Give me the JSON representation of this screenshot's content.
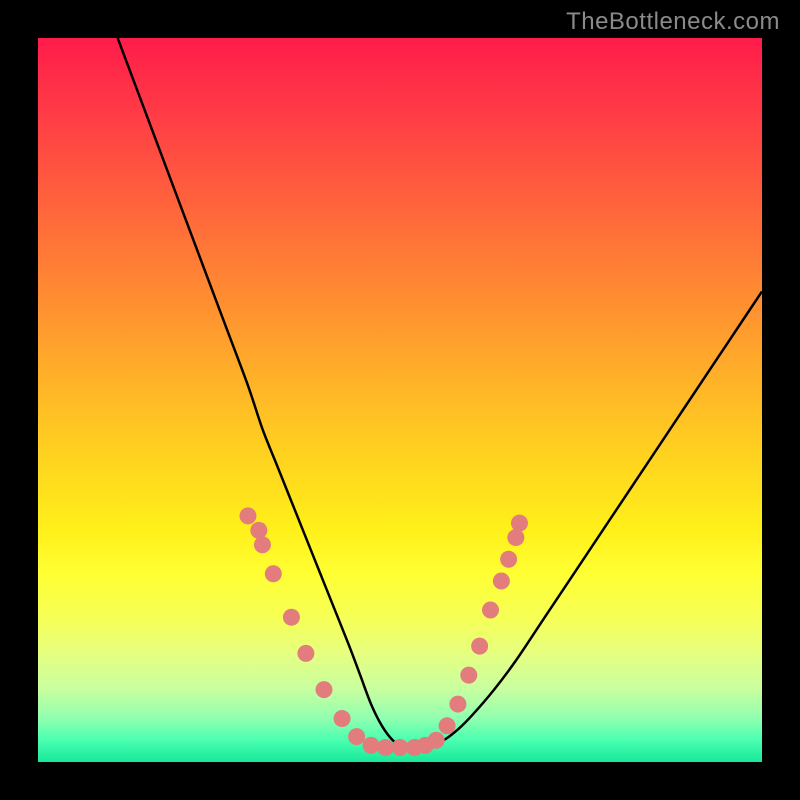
{
  "watermark": "TheBottleneck.com",
  "colors": {
    "frame": "#000000",
    "curve": "#000000",
    "marker_fill": "#e37c7c",
    "marker_stroke": "#b85a5a",
    "gradient_stops": [
      {
        "offset": 0.0,
        "color": "#ff1c4a"
      },
      {
        "offset": 0.1,
        "color": "#ff3a46"
      },
      {
        "offset": 0.2,
        "color": "#ff5a3e"
      },
      {
        "offset": 0.3,
        "color": "#ff7a36"
      },
      {
        "offset": 0.4,
        "color": "#ff9a2e"
      },
      {
        "offset": 0.5,
        "color": "#ffbb26"
      },
      {
        "offset": 0.6,
        "color": "#ffd91e"
      },
      {
        "offset": 0.68,
        "color": "#fff01a"
      },
      {
        "offset": 0.74,
        "color": "#ffff33"
      },
      {
        "offset": 0.8,
        "color": "#f6ff55"
      },
      {
        "offset": 0.85,
        "color": "#e6ff80"
      },
      {
        "offset": 0.9,
        "color": "#c8ffa0"
      },
      {
        "offset": 0.94,
        "color": "#90ffb0"
      },
      {
        "offset": 0.97,
        "color": "#4affb0"
      },
      {
        "offset": 1.0,
        "color": "#18e89a"
      }
    ]
  },
  "chart_data": {
    "type": "line",
    "title": "",
    "xlabel": "",
    "ylabel": "",
    "xlim": [
      0,
      100
    ],
    "ylim": [
      0,
      100
    ],
    "series": [
      {
        "name": "curve",
        "x": [
          11,
          14,
          17,
          20,
          23,
          26,
          29,
          31,
          33,
          35,
          37,
          39,
          41,
          43,
          44.5,
          46,
          47.5,
          49,
          50.5,
          52,
          54,
          56,
          58,
          60,
          63,
          66,
          70,
          74,
          78,
          82,
          86,
          90,
          94,
          98,
          100
        ],
        "y": [
          100,
          92,
          84,
          76,
          68,
          60,
          52,
          46,
          41,
          36,
          31,
          26,
          21,
          16,
          12,
          8,
          5,
          3,
          2,
          2,
          2.3,
          3,
          4.5,
          6.5,
          10,
          14,
          20,
          26,
          32,
          38,
          44,
          50,
          56,
          62,
          65
        ]
      }
    ],
    "markers": {
      "name": "data-points",
      "points": [
        {
          "x": 29.0,
          "y": 34.0
        },
        {
          "x": 30.5,
          "y": 32.0
        },
        {
          "x": 31.0,
          "y": 30.0
        },
        {
          "x": 32.5,
          "y": 26.0
        },
        {
          "x": 35.0,
          "y": 20.0
        },
        {
          "x": 37.0,
          "y": 15.0
        },
        {
          "x": 39.5,
          "y": 10.0
        },
        {
          "x": 42.0,
          "y": 6.0
        },
        {
          "x": 44.0,
          "y": 3.5
        },
        {
          "x": 46.0,
          "y": 2.3
        },
        {
          "x": 48.0,
          "y": 2.0
        },
        {
          "x": 50.0,
          "y": 2.0
        },
        {
          "x": 52.0,
          "y": 2.0
        },
        {
          "x": 53.5,
          "y": 2.3
        },
        {
          "x": 55.0,
          "y": 3.0
        },
        {
          "x": 56.5,
          "y": 5.0
        },
        {
          "x": 58.0,
          "y": 8.0
        },
        {
          "x": 59.5,
          "y": 12.0
        },
        {
          "x": 61.0,
          "y": 16.0
        },
        {
          "x": 62.5,
          "y": 21.0
        },
        {
          "x": 64.0,
          "y": 25.0
        },
        {
          "x": 65.0,
          "y": 28.0
        },
        {
          "x": 66.0,
          "y": 31.0
        },
        {
          "x": 66.5,
          "y": 33.0
        }
      ]
    }
  }
}
